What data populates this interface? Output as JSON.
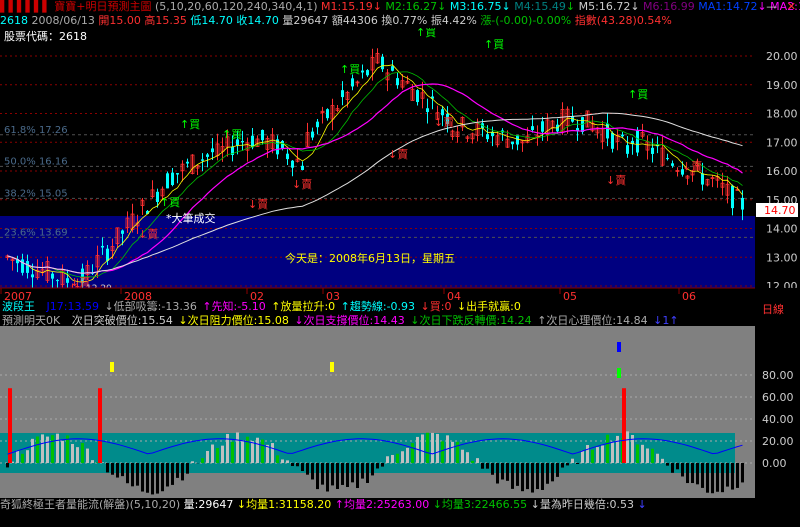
{
  "header1": {
    "prefix": "▌▌▌▌▌▌ 寶寶+明日預測主圖",
    "params": "(5,10,20,60,120,240,340,4,1)",
    "m1": "M1:15.19",
    "m2": "M2:16.27",
    "m3": "M3:16.75",
    "m4": "M4:15.49",
    "m5": "M5:16.72",
    "m6": "M6:16.99",
    "ma1": "MA1:14.72",
    "ma2": "MA2:16.27",
    "arrow_down": "↓",
    "arrow_up": "↑"
  },
  "header2": {
    "code": "2618",
    "date": "2008/06/13",
    "open": "開15.00",
    "high": "高15.35",
    "low": "低14.70",
    "close": "收14.70",
    "volume": "量29647",
    "amount": "額44306",
    "turnover": "換0.77%",
    "amplitude": "振4.42%",
    "change": "漲-(-0.00)-0.00%",
    "index": "指數(43.28)0.54%"
  },
  "window_buttons": {
    "minimize": "—",
    "close": "✕"
  },
  "main_panel": {
    "stock_code_label": "股票代碼：2618",
    "today_label": "今天是：2008年6月13日，星期五",
    "big_trade_label": "*大筆成交",
    "current_price": "14.70",
    "low_marker": "12.20",
    "fib": [
      "61.8% 17.26",
      "50.0% 16.16",
      "38.2% 15.05",
      "23.6% 13.69"
    ],
    "buy_label": "買",
    "sell_label": "賣",
    "price_ticks": [
      "20.00",
      "19.00",
      "18.00",
      "17.00",
      "16.00",
      "15.00",
      "14.00",
      "13.00",
      "12.00"
    ]
  },
  "time_axis": {
    "labels": [
      "2007",
      "2008",
      "02",
      "03",
      "04",
      "05",
      "06"
    ],
    "period_label": "日線"
  },
  "indicator_bar": {
    "wave": "波段王",
    "j17": "J17:13.59",
    "cost": "↓低部吸籌:-13.36",
    "early": "↑先知:-5.10",
    "volume_up": "↑放量拉升:0",
    "pull": "↑趨勢線:-0.93",
    "buy": "↓買:0",
    "win": "↓出手就贏:0"
  },
  "predict_bar": {
    "title": "預測明天0K",
    "breakout": "次日突破價位:15.54",
    "resistance": "↓次日阻力價位:15.08",
    "support": "↓次日支撐價位:14.43",
    "break_down": "↓次日下跌反轉價:14.24",
    "psych": "↑次日心理價位:14.84",
    "tail": "↓1↑"
  },
  "lower_ticks": [
    "80.00",
    "60.00",
    "40.00",
    "20.00",
    "0.00"
  ],
  "footer": {
    "row1": "奇狐終極王者量能流(解盤)(5,10,20)",
    "vol": "量:29647",
    "avg1": "↓均量1:31158.20",
    "avg2": "↑均量2:25263.00",
    "avg3": "↓均量3:22466.55",
    "ratio": "↓量為昨日幾倍:0.53",
    "tail": "↓"
  },
  "colors": {
    "up": "#ff3030",
    "down": "#00ffff",
    "navy": "#000080",
    "grid": "#8b0000",
    "ma_white": "#e0e0e0",
    "ma_magenta": "#ff00ff",
    "ma_green": "#00c000",
    "yellow": "#ffff00",
    "panel_gray": "#808080",
    "teal": "#008b8b"
  }
}
